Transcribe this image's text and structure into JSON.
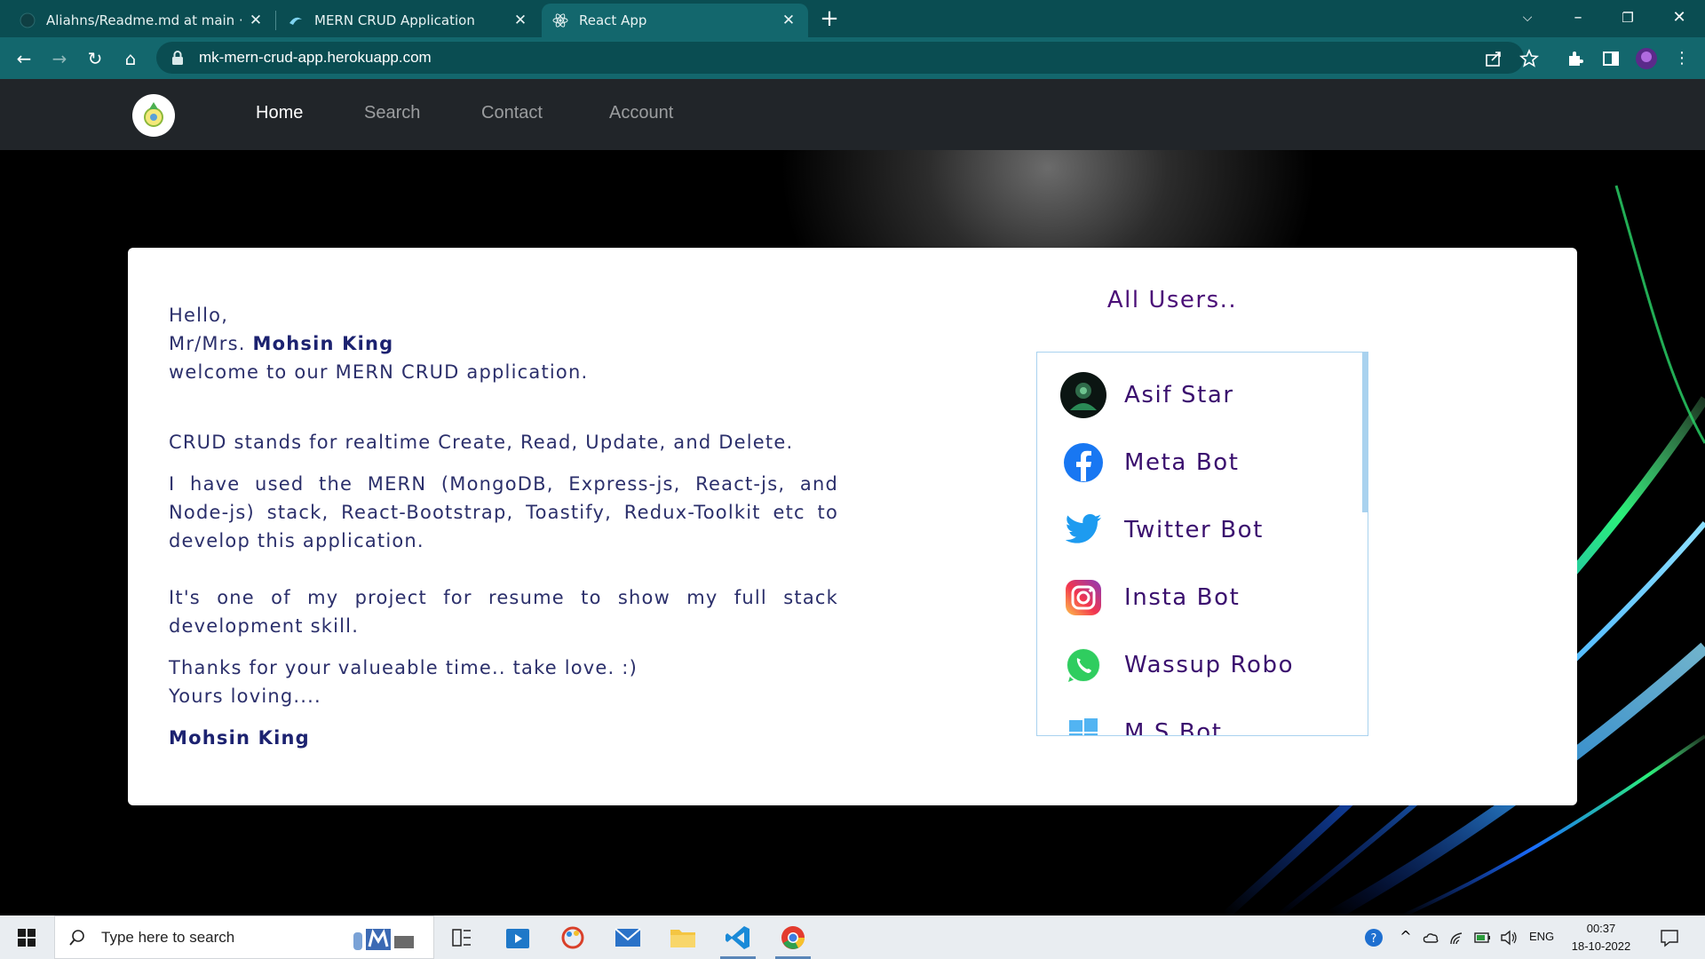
{
  "browser": {
    "tabs": [
      {
        "title": "Aliahns/Readme.md at main · Mo"
      },
      {
        "title": "MERN CRUD Application"
      },
      {
        "title": "React App"
      }
    ],
    "url": "mk-mern-crud-app.herokuapp.com"
  },
  "navbar": {
    "links": [
      {
        "label": "Home"
      },
      {
        "label": "Search"
      },
      {
        "label": "Contact"
      },
      {
        "label": "Account"
      }
    ]
  },
  "intro": {
    "greeting": "Hello,",
    "salutation": "Mr/Mrs.",
    "user_name": "Mohsin King",
    "welcome": "welcome to our MERN CRUD application.",
    "p1": "CRUD stands for realtime Create, Read, Update, and Delete.",
    "p2": "I have used the MERN (MongoDB, Express-js, React-js, and Node-js) stack, React-Bootstrap, Toastify, Redux-Toolkit etc to develop this application.",
    "p3": "It's one of my project for resume to show my full stack development skill.",
    "p4": "Thanks for your valueable time.. take love. :)",
    "p5": "Yours loving....",
    "signature": "Mohsin King"
  },
  "users": {
    "title": "All Users..",
    "items": [
      {
        "name": "Asif Star",
        "icon": "avatar-photo"
      },
      {
        "name": "Meta Bot",
        "icon": "facebook-icon"
      },
      {
        "name": "Twitter Bot",
        "icon": "twitter-icon"
      },
      {
        "name": "Insta Bot",
        "icon": "instagram-icon"
      },
      {
        "name": "Wassup Robo",
        "icon": "whatsapp-icon"
      },
      {
        "name": "M S Bot",
        "icon": "windows-icon"
      }
    ]
  },
  "taskbar": {
    "search_placeholder": "Type here to search",
    "language": "ENG",
    "time": "00:37",
    "date": "18-10-2022"
  },
  "colors": {
    "browser_frame": "#0a4d52",
    "browser_toolbar": "#13676d",
    "navbar": "#212529",
    "user_name_text": "#3a0f6e",
    "list_border": "#a9d2ef"
  }
}
